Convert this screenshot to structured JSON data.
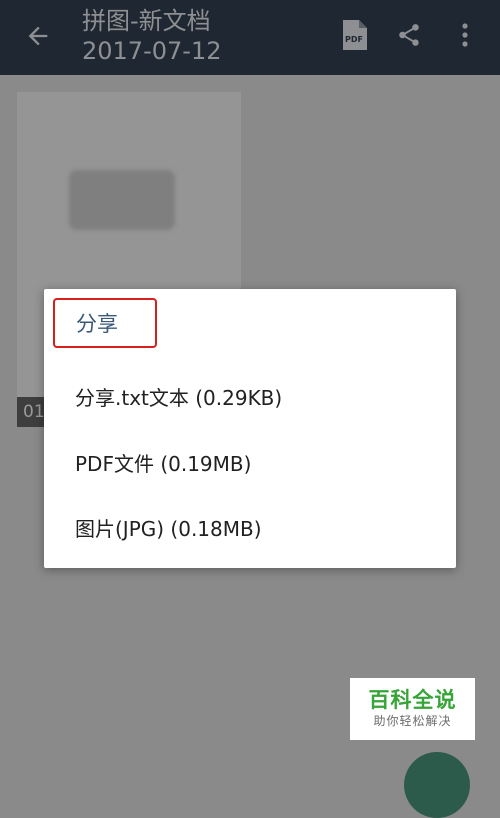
{
  "appbar": {
    "title": "拼图-新文档",
    "subtitle": "2017-07-12",
    "back_icon": "arrow-left-icon",
    "pdf_icon": "pdf-icon",
    "pdf_icon_text": "PDF",
    "share_icon": "share-icon",
    "more_icon": "more-vert-icon",
    "background": "#1f2832"
  },
  "page": {
    "thumbnail_index": "01"
  },
  "dialog": {
    "title": "分享",
    "title_highlight_color": "#d8201e",
    "items": [
      {
        "label": "分享.txt文本 (0.29KB)"
      },
      {
        "label": "PDF文件 (0.19MB)"
      },
      {
        "label": "图片(JPG) (0.18MB)"
      }
    ]
  },
  "watermark": {
    "main": "百科全说",
    "sub": "助你轻松解决",
    "color": "#36a436"
  }
}
